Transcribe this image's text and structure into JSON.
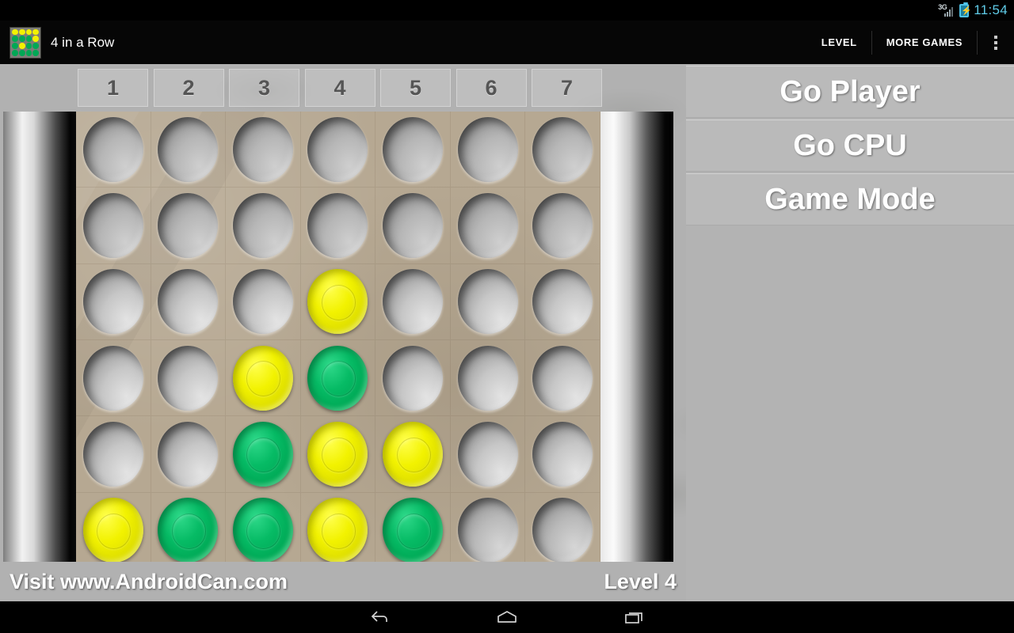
{
  "statusbar": {
    "network_icon": "signal-3g-icon",
    "network_label": "3G",
    "battery_icon": "battery-charging-icon",
    "clock": "11:54"
  },
  "actionbar": {
    "app_icon": "four-in-a-row-app-icon",
    "title": "4 in a Row",
    "level_label": "LEVEL",
    "more_games_label": "MORE GAMES",
    "overflow_icon": "overflow-menu-icon"
  },
  "columns": [
    {
      "label": "1"
    },
    {
      "label": "2"
    },
    {
      "label": "3"
    },
    {
      "label": "4"
    },
    {
      "label": "5"
    },
    {
      "label": "6"
    },
    {
      "label": "7"
    }
  ],
  "panel": {
    "go_player_label": "Go Player",
    "go_cpu_label": "Go CPU",
    "game_mode_label": "Game Mode"
  },
  "footer": {
    "visit_text": "Visit www.AndroidCan.com",
    "level_text": "Level 4"
  },
  "navbar": {
    "back_icon": "back-arrow-icon",
    "home_icon": "home-icon",
    "recents_icon": "recent-apps-icon"
  },
  "colors": {
    "yellow_chip": "#f2f200",
    "green_chip": "#00a855",
    "empty_cell": "#b6b6b6",
    "board": "#b6a892",
    "panel_bg": "#b3b3b3",
    "actionbar_bg": "#060606",
    "clock_text": "#5fcbe8"
  },
  "board": {
    "rows": 6,
    "cols": 7,
    "legend": {
      "empty": "empty",
      "yellow": "yellow",
      "green": "green"
    },
    "cells": [
      [
        "empty",
        "empty",
        "empty",
        "empty",
        "empty",
        "empty",
        "empty"
      ],
      [
        "empty",
        "empty",
        "empty",
        "empty",
        "empty",
        "empty",
        "empty"
      ],
      [
        "empty",
        "empty",
        "empty",
        "yellow",
        "empty",
        "empty",
        "empty"
      ],
      [
        "empty",
        "empty",
        "yellow",
        "green",
        "empty",
        "empty",
        "empty"
      ],
      [
        "empty",
        "empty",
        "green",
        "yellow",
        "yellow",
        "empty",
        "empty"
      ],
      [
        "yellow",
        "green",
        "green",
        "yellow",
        "green",
        "empty",
        "empty"
      ]
    ]
  },
  "app_icon_grid": [
    [
      "yellow",
      "yellow",
      "yellow",
      "yellow"
    ],
    [
      "green",
      "green",
      "green",
      "yellow"
    ],
    [
      "green",
      "yellow",
      "green",
      "green"
    ],
    [
      "green",
      "green",
      "green",
      "green"
    ]
  ]
}
